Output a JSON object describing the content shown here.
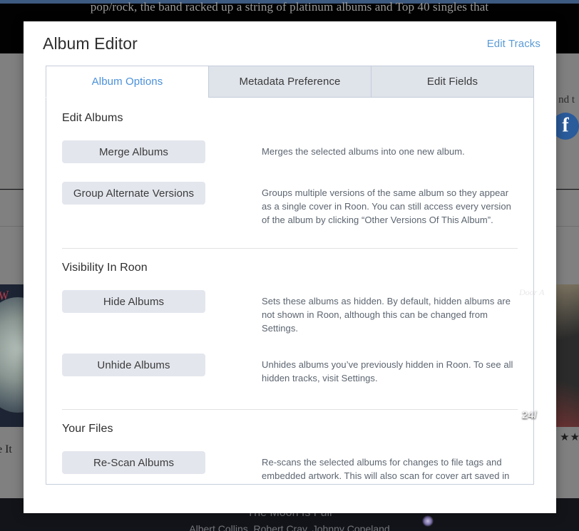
{
  "background": {
    "bio_text": "pop/rock, the band racked up a string of platinum albums and Top 40 singles that",
    "social_snippet": "nd t",
    "social_icons": [
      {
        "name": "twitter-icon",
        "glyph": ""
      },
      {
        "name": "facebook-icon",
        "glyph": "f"
      }
    ],
    "albums": [
      {
        "art_script": "W",
        "caption": "ke It",
        "badge": ""
      },
      {
        "art_script": "Door A",
        "badge": "24/",
        "stars": "★★"
      }
    ],
    "now_playing": {
      "title": "The Moon Is Full",
      "artist": "Albert Collins, Robert Cray, Johnny Copeland"
    }
  },
  "modal": {
    "title": "Album Editor",
    "edit_tracks_label": "Edit Tracks",
    "tabs": [
      {
        "label": "Album Options",
        "active": true
      },
      {
        "label": "Metadata Preference",
        "active": false
      },
      {
        "label": "Edit Fields",
        "active": false
      }
    ],
    "sections": [
      {
        "title": "Edit Albums",
        "options": [
          {
            "button": "Merge Albums",
            "description": "Merges the selected albums into one new album."
          },
          {
            "button": "Group Alternate Versions",
            "description": "Groups multiple versions of the same album so they appear as a single cover in Roon. You can still access every version of the album by clicking “Other Versions Of This Album”."
          }
        ]
      },
      {
        "title": "Visibility In Roon",
        "options": [
          {
            "button": "Hide Albums",
            "description": "Sets these albums as hidden. By default, hidden albums are not shown in Roon, although this can be changed from Settings."
          },
          {
            "button": "Unhide Albums",
            "description": "Unhides albums you’ve previously hidden in Roon. To see all hidden tracks, visit Settings."
          }
        ]
      },
      {
        "title": "Your Files",
        "options": [
          {
            "button": "Re-Scan Albums",
            "description": "Re-scans the selected albums for changes to file tags and embedded artwork. This will also scan for cover art saved in the"
          }
        ]
      }
    ]
  },
  "colors": {
    "accent_blue": "#4a90d9",
    "link_blue": "#5b9bd5",
    "button_bg": "#e3e6ed",
    "tab_inactive_bg": "#dfe3ea",
    "border": "#c5cdda",
    "backdrop_gray": "#808080",
    "backdrop_dark": "#131419"
  }
}
